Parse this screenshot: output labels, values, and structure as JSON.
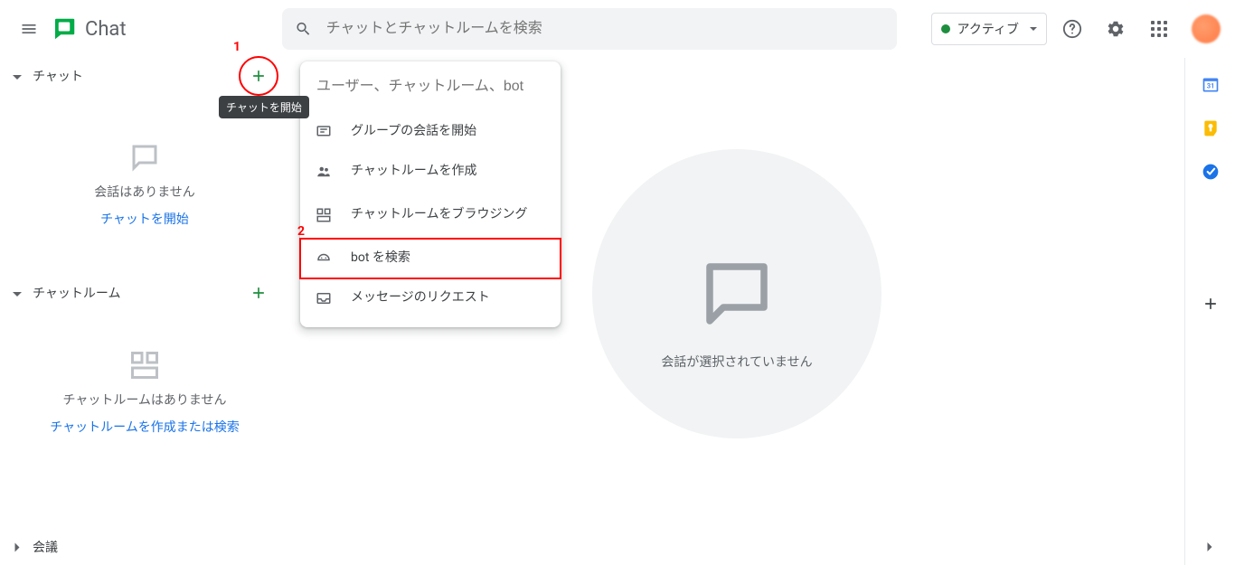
{
  "header": {
    "app_name": "Chat",
    "search_placeholder": "チャットとチャットルームを検索",
    "status_label": "アクティブ"
  },
  "sidebar": {
    "chat": {
      "title": "チャット",
      "empty_text": "会話はありません",
      "link_text": "チャットを開始",
      "plus_tooltip": "チャットを開始"
    },
    "rooms": {
      "title": "チャットルーム",
      "empty_text": "チャットルームはありません",
      "link_text": "チャットルームを作成または検索"
    },
    "meetings": {
      "title": "会議"
    }
  },
  "popup": {
    "search_placeholder": "ユーザー、チャットルーム、bot",
    "items": [
      {
        "icon": "chat-icon",
        "label": "グループの会話を開始"
      },
      {
        "icon": "people-icon",
        "label": "チャットルームを作成"
      },
      {
        "icon": "grid-icon",
        "label": "チャットルームをブラウジング"
      },
      {
        "icon": "bot-icon",
        "label": "bot を検索"
      },
      {
        "icon": "inbox-icon",
        "label": "メッセージのリクエスト"
      }
    ]
  },
  "main": {
    "no_selection_text": "会話が選択されていません"
  },
  "callouts": {
    "one": "1",
    "two": "2"
  },
  "right_rail": {
    "calendar_day": "31"
  }
}
